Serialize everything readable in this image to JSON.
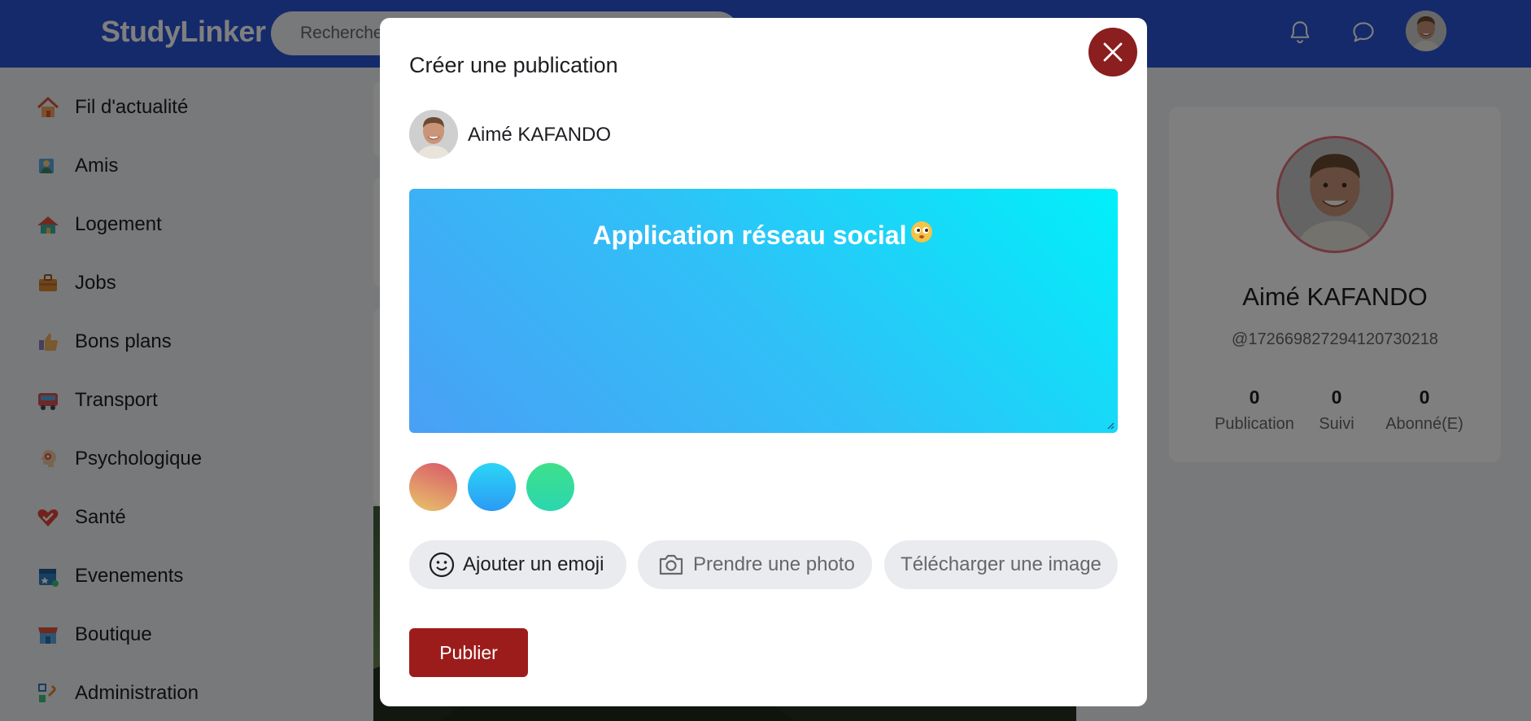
{
  "header": {
    "logo": "StudyLinker",
    "search_placeholder": "Recherche",
    "icons": [
      "bell-icon",
      "message-icon"
    ]
  },
  "sidebar": {
    "items": [
      {
        "label": "Fil d'actualité",
        "icon": "home-icon"
      },
      {
        "label": "Amis",
        "icon": "friends-icon"
      },
      {
        "label": "Logement",
        "icon": "house-icon"
      },
      {
        "label": "Jobs",
        "icon": "briefcase-icon"
      },
      {
        "label": "Bons plans",
        "icon": "thumbs-up-icon"
      },
      {
        "label": "Transport",
        "icon": "bus-icon"
      },
      {
        "label": "Psychologique",
        "icon": "head-icon"
      },
      {
        "label": "Santé",
        "icon": "heart-check-icon"
      },
      {
        "label": "Evenements",
        "icon": "calendar-icon"
      },
      {
        "label": "Boutique",
        "icon": "shop-icon"
      },
      {
        "label": "Administration",
        "icon": "admin-icon"
      }
    ]
  },
  "profile": {
    "name": "Aimé KAFANDO",
    "handle": "@1726698272941207302​18",
    "stats": [
      {
        "value": "0",
        "label": "Publication"
      },
      {
        "value": "0",
        "label": "Suivi"
      },
      {
        "value": "0",
        "label": "Abonné(E)"
      }
    ]
  },
  "modal": {
    "title": "Créer une publication",
    "user_name": "Aimé KAFANDO",
    "post_text": "Application réseau social",
    "post_emoji": "emoji-icon",
    "colors": {
      "swatch_1": "#e8c46a",
      "swatch_2": "#2bb8f5",
      "swatch_3": "#3ee08a",
      "close_button": "#8b1e1e",
      "publish_button": "#9c1c1c"
    },
    "actions": {
      "emoji": "Ajouter un emoji",
      "photo": "Prendre une photo",
      "upload": "Télécharger une image"
    },
    "publish_label": "Publier"
  }
}
